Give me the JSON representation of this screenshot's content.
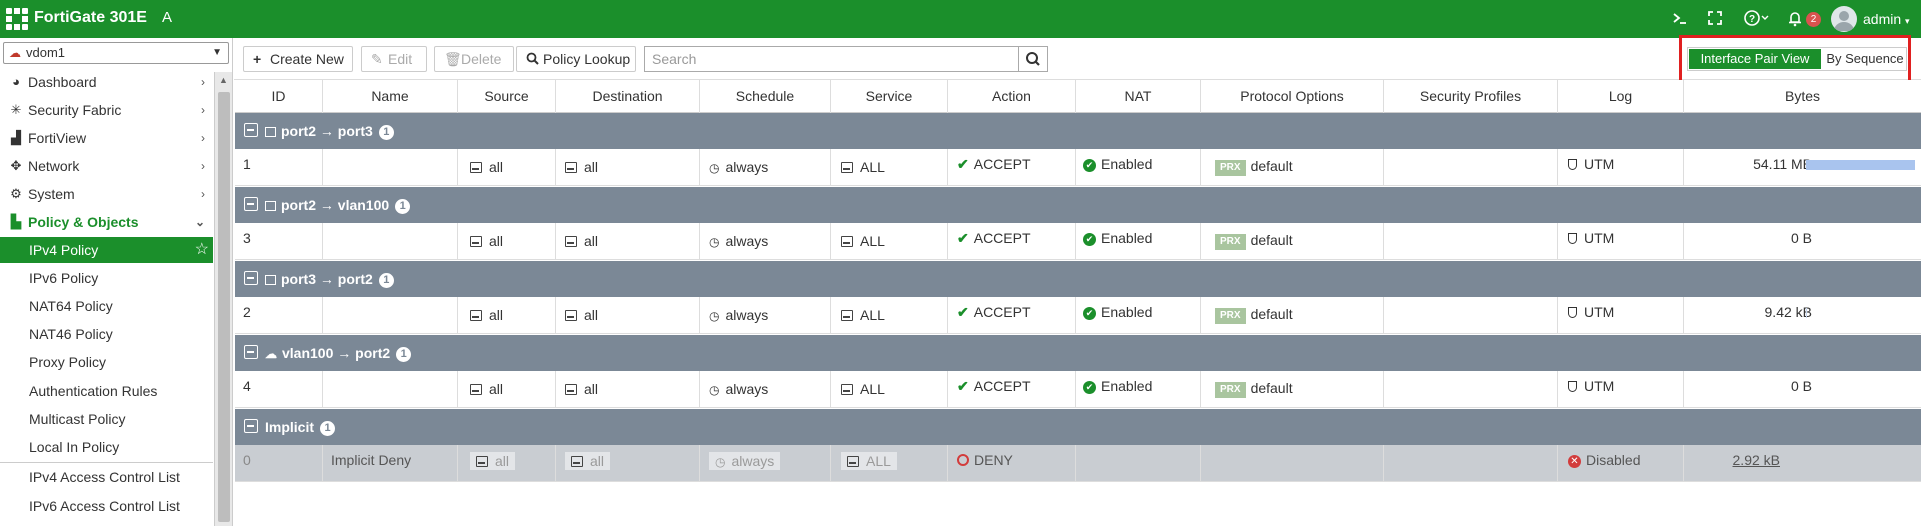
{
  "topbar": {
    "brand": "FortiGate 301E",
    "hostname": "A",
    "notification_count": "2",
    "user": "admin",
    "icons": [
      "cli-console-icon",
      "fullscreen-icon",
      "help-icon",
      "notification-bell-icon",
      "user-avatar-icon"
    ]
  },
  "sidebar": {
    "vdom": "vdom1",
    "items": [
      {
        "label": "Dashboard",
        "icon": "dashboard-icon"
      },
      {
        "label": "Security Fabric",
        "icon": "security-fabric-icon"
      },
      {
        "label": "FortiView",
        "icon": "fortiview-icon"
      },
      {
        "label": "Network",
        "icon": "network-icon"
      },
      {
        "label": "System",
        "icon": "gear-icon"
      },
      {
        "label": "Policy & Objects",
        "icon": "policy-icon"
      }
    ],
    "subitems": [
      "IPv4 Policy",
      "IPv6 Policy",
      "NAT64 Policy",
      "NAT46 Policy",
      "Proxy Policy",
      "Authentication Rules",
      "Multicast Policy",
      "Local In Policy",
      "IPv4 Access Control List",
      "IPv6 Access Control List"
    ]
  },
  "toolbar": {
    "create_new": "Create New",
    "edit": "Edit",
    "delete": "Delete",
    "policy_lookup": "Policy Lookup",
    "search_placeholder": "Search",
    "view_pair": "Interface Pair View",
    "view_sequence": "By Sequence"
  },
  "table": {
    "headers": [
      "ID",
      "Name",
      "Source",
      "Destination",
      "Schedule",
      "Service",
      "Action",
      "NAT",
      "Protocol Options",
      "Security Profiles",
      "Log",
      "Bytes"
    ],
    "groups": [
      {
        "label": "port2 → port3",
        "count": "1",
        "row": {
          "id": "1",
          "name": "",
          "source": "all",
          "destination": "all",
          "schedule": "always",
          "service": "ALL",
          "action": "ACCEPT",
          "nat": "Enabled",
          "prx": "PRX",
          "protocol": "default",
          "log": "UTM",
          "bytes": "54.11 MB",
          "bytes_fraction": 1.0
        }
      },
      {
        "label": "port2 → vlan100",
        "count": "1",
        "row": {
          "id": "3",
          "name": "",
          "source": "all",
          "destination": "all",
          "schedule": "always",
          "service": "ALL",
          "action": "ACCEPT",
          "nat": "Enabled",
          "prx": "PRX",
          "protocol": "default",
          "log": "UTM",
          "bytes": "0 B",
          "bytes_fraction": 0
        }
      },
      {
        "label": "port3 → port2",
        "count": "1",
        "row": {
          "id": "2",
          "name": "",
          "source": "all",
          "destination": "all",
          "schedule": "always",
          "service": "ALL",
          "action": "ACCEPT",
          "nat": "Enabled",
          "prx": "PRX",
          "protocol": "default",
          "log": "UTM",
          "bytes": "9.42 kB",
          "bytes_fraction": 0.01
        }
      },
      {
        "label": "vlan100 → port2",
        "count": "1",
        "row": {
          "id": "4",
          "name": "",
          "source": "all",
          "destination": "all",
          "schedule": "always",
          "service": "ALL",
          "action": "ACCEPT",
          "nat": "Enabled",
          "prx": "PRX",
          "protocol": "default",
          "log": "UTM",
          "bytes": "0 B",
          "bytes_fraction": 0
        }
      }
    ],
    "implicit": {
      "label": "Implicit",
      "count": "1",
      "row": {
        "id": "0",
        "name": "Implicit Deny",
        "source": "all",
        "destination": "all",
        "schedule": "always",
        "service": "ALL",
        "action": "DENY",
        "log": "Disabled",
        "bytes": "2.92 kB"
      }
    }
  }
}
